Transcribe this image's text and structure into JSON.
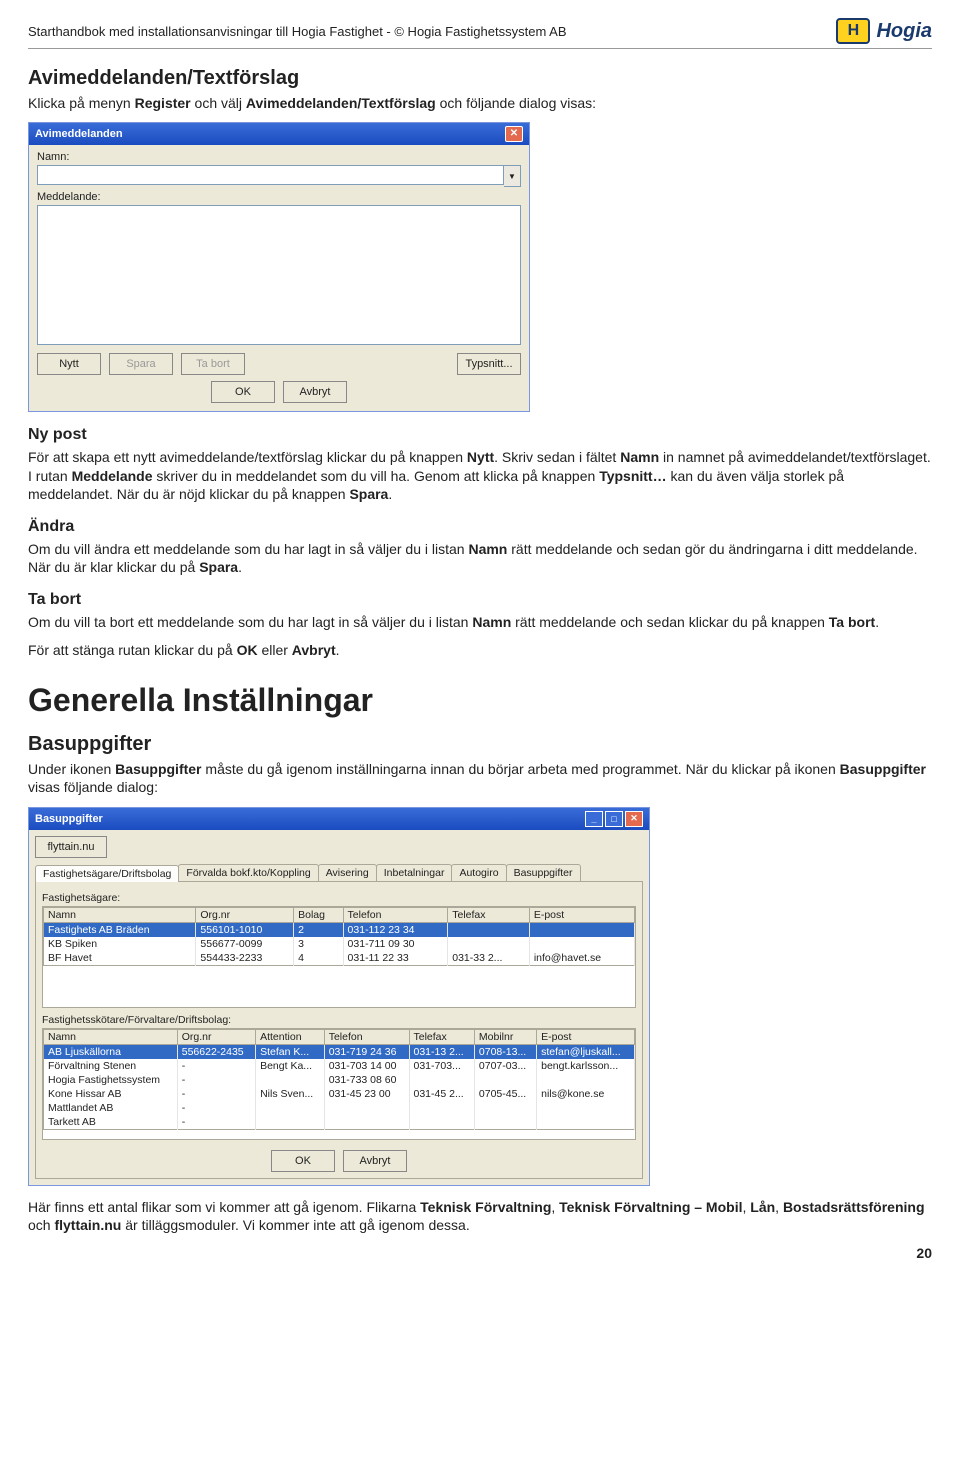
{
  "header": {
    "title": "Starthandbok med installationsanvisningar till Hogia Fastighet - © Hogia Fastighetssystem AB",
    "logo_letter": "H",
    "logo_text": "Hogia"
  },
  "s1": {
    "heading": "Avimeddelanden/Textförslag",
    "intro_a": "Klicka på menyn ",
    "intro_b": "Register",
    "intro_c": " och välj ",
    "intro_d": "Avimeddelanden/Textförslag",
    "intro_e": " och följande dialog visas:"
  },
  "dlg1": {
    "title": "Avimeddelanden",
    "lbl_namn": "Namn:",
    "lbl_medd": "Meddelande:",
    "btn_nytt": "Nytt",
    "btn_spara": "Spara",
    "btn_tabort": "Ta bort",
    "btn_typsnitt": "Typsnitt...",
    "btn_ok": "OK",
    "btn_avbryt": "Avbryt"
  },
  "nypost": {
    "h": "Ny post",
    "p1a": "För att skapa ett nytt avimeddelande/textförslag klickar du på knappen ",
    "p1b": "Nytt",
    "p1c": ". Skriv sedan i fältet ",
    "p1d": "Namn",
    "p1e": " in namnet på avimeddelandet/textförslaget. I rutan ",
    "p1f": "Meddelande",
    "p1g": " skriver du in meddelandet som du vill ha. Genom att klicka på knappen ",
    "p1h": "Typsnitt…",
    "p1i": " kan du även välja storlek på meddelandet. När du är nöjd klickar du på knappen ",
    "p1j": "Spara",
    "p1k": "."
  },
  "andra": {
    "h": "Ändra",
    "a": "Om du vill ändra ett meddelande som du har lagt in så väljer du i listan ",
    "b": "Namn",
    "c": " rätt meddelande och sedan gör du ändringarna i ditt meddelande. När du är klar klickar du på ",
    "d": "Spara",
    "e": "."
  },
  "tabort": {
    "h": "Ta bort",
    "a": "Om du vill ta bort ett meddelande som du har lagt in så väljer du i listan ",
    "b": "Namn",
    "c": " rätt meddelande och sedan klickar du på knappen ",
    "d": "Ta bort",
    "e": ".",
    "close_a": "För att stänga rutan klickar du på ",
    "close_b": "OK",
    "close_c": " eller ",
    "close_d": "Avbryt",
    "close_e": "."
  },
  "gen": {
    "h": "Generella Inställningar",
    "sub": "Basuppgifter",
    "p1a": "Under ikonen ",
    "p1b": "Basuppgifter",
    "p1c": " måste du gå igenom inställningarna innan du börjar arbeta med programmet. När du klickar på ikonen ",
    "p1d": "Basuppgifter",
    "p1e": " visas följande dialog:"
  },
  "dlg2": {
    "title": "Basuppgifter",
    "btn_flyttain": "flyttain.nu",
    "tabs": [
      "Fastighetsägare/Driftsbolag",
      "Förvalda bokf.kto/Koppling",
      "Avisering",
      "Inbetalningar",
      "Autogiro",
      "Basuppgifter"
    ],
    "grp1_label": "Fastighetsägare:",
    "cols1": [
      "Namn",
      "Org.nr",
      "Bolag",
      "Telefon",
      "Telefax",
      "E-post"
    ],
    "rows1": [
      [
        "Fastighets AB Bräden",
        "556101-1010",
        "2",
        "031-112 23 34",
        "",
        ""
      ],
      [
        "KB Spiken",
        "556677-0099",
        "3",
        "031-711 09 30",
        "",
        ""
      ],
      [
        "BF Havet",
        "554433-2233",
        "4",
        "031-11 22 33",
        "031-33 2...",
        "info@havet.se"
      ]
    ],
    "grp2_label": "Fastighetsskötare/Förvaltare/Driftsbolag:",
    "cols2": [
      "Namn",
      "Org.nr",
      "Attention",
      "Telefon",
      "Telefax",
      "Mobilnr",
      "E-post"
    ],
    "rows2": [
      [
        "AB Ljuskällorna",
        "556622-2435",
        "Stefan K...",
        "031-719 24 36",
        "031-13 2...",
        "0708-13...",
        "stefan@ljuskall..."
      ],
      [
        "Förvaltning Stenen",
        "-",
        "Bengt Ka...",
        "031-703 14 00",
        "031-703...",
        "0707-03...",
        "bengt.karlsson..."
      ],
      [
        "Hogia Fastighetssystem",
        "-",
        "",
        "031-733 08 60",
        "",
        "",
        ""
      ],
      [
        "Kone Hissar AB",
        "-",
        "Nils Sven...",
        "031-45 23 00",
        "031-45 2...",
        "0705-45...",
        "nils@kone.se"
      ],
      [
        "Mattlandet AB",
        "-",
        "",
        "",
        "",
        "",
        ""
      ],
      [
        "Tarkett AB",
        "-",
        "",
        "",
        "",
        "",
        ""
      ]
    ],
    "btn_ok": "OK",
    "btn_avbryt": "Avbryt"
  },
  "closing": {
    "a": "Här finns ett antal flikar som vi kommer att gå igenom. Flikarna ",
    "b": "Teknisk Förvaltning",
    "c": ", ",
    "d": "Teknisk Förvaltning – Mobil",
    "e": ", ",
    "f": "Lån",
    "g": ", ",
    "h": "Bostadsrättsförening",
    "i": " och ",
    "j": "flyttain.nu",
    "k": " är tilläggsmoduler. Vi kommer inte att gå igenom dessa."
  },
  "page_number": "20"
}
